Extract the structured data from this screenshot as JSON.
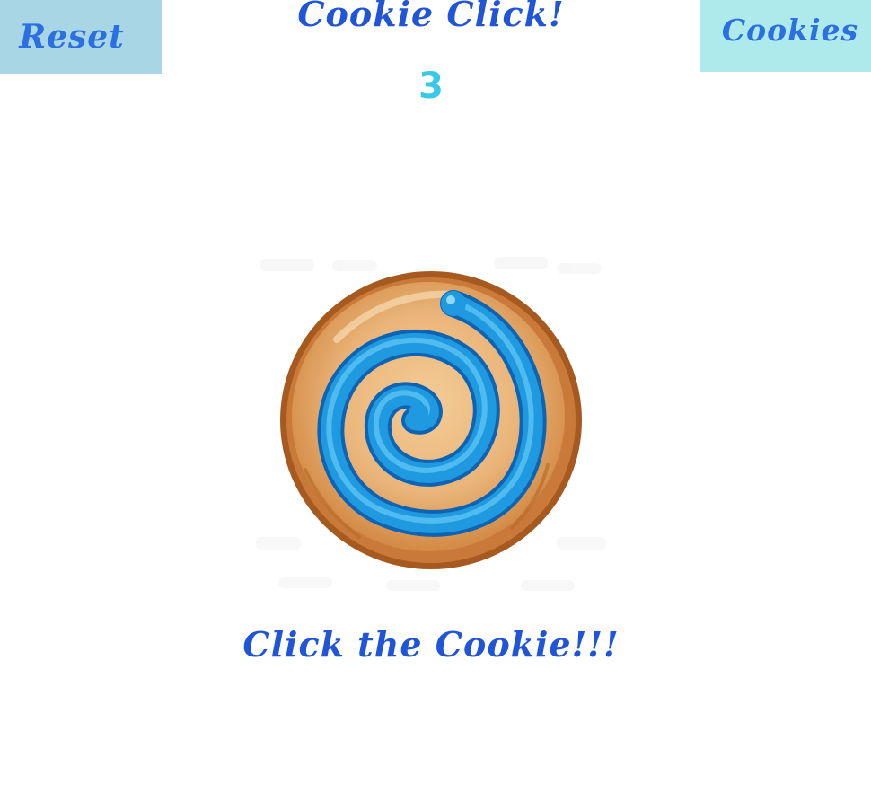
{
  "header": {
    "title": "Cookie Click!",
    "reset_label": "Reset",
    "cookies_label": "Cookies"
  },
  "counter": {
    "value": "3"
  },
  "cookie": {
    "icon": "cookie-icon",
    "caption": "Click the Cookie!!!"
  },
  "colors": {
    "reset_bg": "#a9d6e5",
    "cookies_bg": "#aeeaec",
    "text_blue": "#1f55d6",
    "counter_cyan": "#3ac8e8",
    "cookie_dough": "#e8ad6c",
    "cookie_crust": "#a75a1f",
    "icing_blue": "#1f9ae0"
  }
}
